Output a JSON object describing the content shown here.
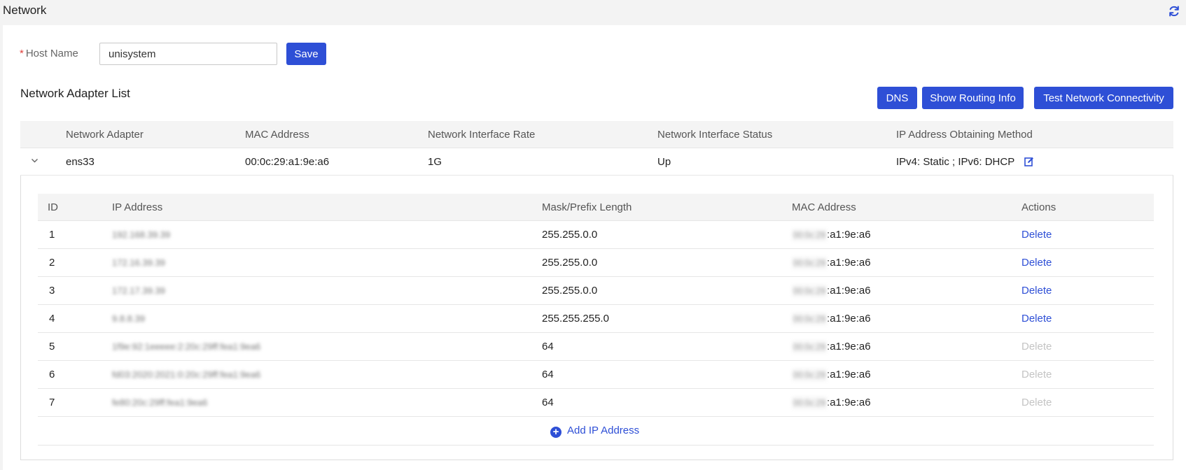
{
  "header": {
    "title": "Network",
    "refresh_icon": "refresh-icon"
  },
  "host": {
    "required_mark": "*",
    "label": "Host Name",
    "value": "unisystem",
    "save_label": "Save"
  },
  "adapters_section": {
    "title": "Network Adapter List",
    "buttons": {
      "dns": "DNS",
      "routing": "Show Routing Info",
      "connectivity": "Test Network Connectivity"
    },
    "columns": {
      "adapter": "Network Adapter",
      "mac": "MAC Address",
      "rate": "Network Interface Rate",
      "status": "Network Interface Status",
      "method": "IP Address Obtaining Method"
    },
    "adapter": {
      "name": "ens33",
      "mac": "00:0c:29:a1:9e:a6",
      "rate": "1G",
      "status": "Up",
      "method": "IPv4: Static ; IPv6: DHCP",
      "edit_icon": "edit-icon"
    }
  },
  "ip_table": {
    "columns": {
      "id": "ID",
      "ip": "IP Address",
      "mask": "Mask/Prefix Length",
      "mac": "MAC Address",
      "actions": "Actions"
    },
    "rows": [
      {
        "id": "1",
        "ip": "192.168.39.39",
        "mask": "255.255.0.0",
        "mac_hidden": "00:0c:29",
        "mac_visible": ":a1:9e:a6",
        "action": "Delete"
      },
      {
        "id": "2",
        "ip": "172.16.39.39",
        "mask": "255.255.0.0",
        "mac_hidden": "00:0c:29",
        "mac_visible": ":a1:9e:a6",
        "action": "Delete"
      },
      {
        "id": "3",
        "ip": "172.17.39.39",
        "mask": "255.255.0.0",
        "mac_hidden": "00:0c:29",
        "mac_visible": ":a1:9e:a6",
        "action": "Delete"
      },
      {
        "id": "4",
        "ip": "9.8.8.39",
        "mask": "255.255.255.0",
        "mac_hidden": "00:0c:29",
        "mac_visible": ":a1:9e:a6",
        "action": "Delete"
      },
      {
        "id": "5",
        "ip": "1f9e:92:1eeeee:2:20c:29ff:fea1:9ea6",
        "mask": "64",
        "mac_hidden": "00:0c:29",
        "mac_visible": ":a1:9e:a6",
        "action": "Delete"
      },
      {
        "id": "6",
        "ip": "fd03:2020:2021:0:20c:29ff:fea1:9ea6",
        "mask": "64",
        "mac_hidden": "00:0c:29",
        "mac_visible": ":a1:9e:a6",
        "action": "Delete"
      },
      {
        "id": "7",
        "ip": "fe80:20c:29ff:fea1:9ea6",
        "mask": "64",
        "mac_hidden": "00:0c:29",
        "mac_visible": ":a1:9e:a6",
        "action": "Delete"
      }
    ],
    "add_label": "Add IP Address",
    "add_icon": "plus-circle-icon"
  }
}
